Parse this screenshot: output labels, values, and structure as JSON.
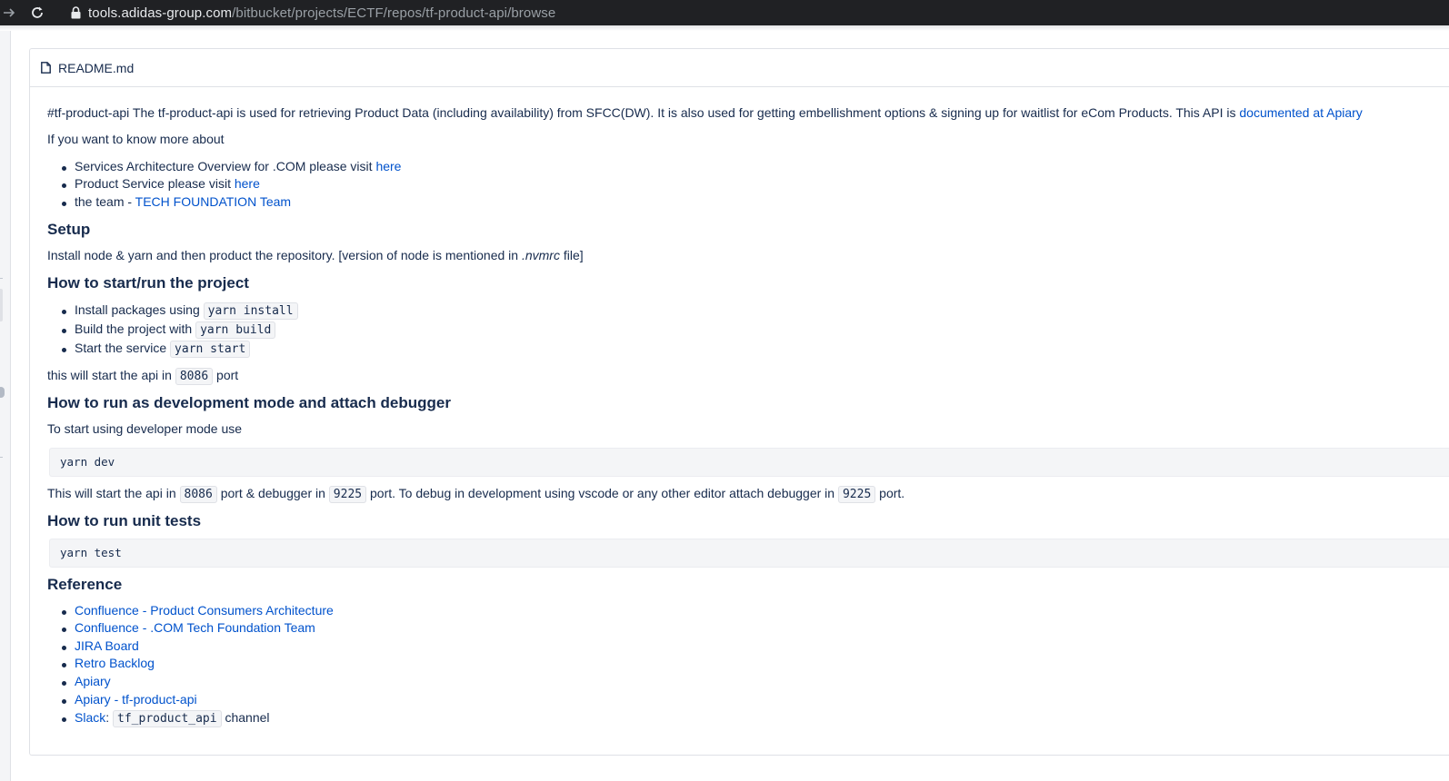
{
  "browser": {
    "url_host": "tools.adidas-group.com",
    "url_path": "/bitbucket/projects/ECTF/repos/tf-product-api/browse"
  },
  "readme": {
    "file_name": "README.md",
    "intro": {
      "text": "#tf-product-api The tf-product-api is used for retrieving Product Data (including availability) from SFCC(DW). It is also used for getting embellishment options & signing up for waitlist for eCom Products. This API is ",
      "link": "documented at Apiary"
    },
    "know_more": "If you want to know more about",
    "know_more_items": [
      {
        "text": "Services Architecture Overview for .COM please visit ",
        "link": "here"
      },
      {
        "text": "Product Service please visit ",
        "link": "here"
      },
      {
        "text": "the team - ",
        "link": "TECH FOUNDATION Team"
      }
    ],
    "setup": {
      "heading": "Setup",
      "text_before": "Install node & yarn and then product the repository. [version of node is mentioned in ",
      "text_em": ".nvmrc",
      "text_after": " file]"
    },
    "start": {
      "heading": "How to start/run the project",
      "items": [
        {
          "text": "Install packages using ",
          "code": "yarn install"
        },
        {
          "text": "Build the project with ",
          "code": "yarn build"
        },
        {
          "text": "Start the service ",
          "code": "yarn start"
        }
      ],
      "port_before": "this will start the api in ",
      "port_code": "8086",
      "port_after": " port"
    },
    "dev": {
      "heading": "How to run as development mode and attach debugger",
      "intro": "To start using developer mode use",
      "code_block": "yarn dev",
      "line_1": "This will start the api in ",
      "code_1": "8086",
      "line_2": " port & debugger in ",
      "code_2": "9225",
      "line_3": " port. To debug in development using vscode or any other editor attach debugger in ",
      "code_3": "9225",
      "line_4": " port."
    },
    "tests": {
      "heading": "How to run unit tests",
      "code_block": "yarn test"
    },
    "reference": {
      "heading": "Reference",
      "links": [
        "Confluence - Product Consumers Architecture",
        "Confluence - .COM Tech Foundation Team",
        "JIRA Board",
        "Retro Backlog",
        "Apiary",
        "Apiary - tf-product-api"
      ],
      "slack_link": "Slack",
      "slack_sep": ": ",
      "slack_code": "tf_product_api",
      "slack_after": " channel"
    }
  },
  "colors": {
    "link": "#0052cc",
    "text": "#172b4d",
    "browser_bar": "#202124"
  }
}
